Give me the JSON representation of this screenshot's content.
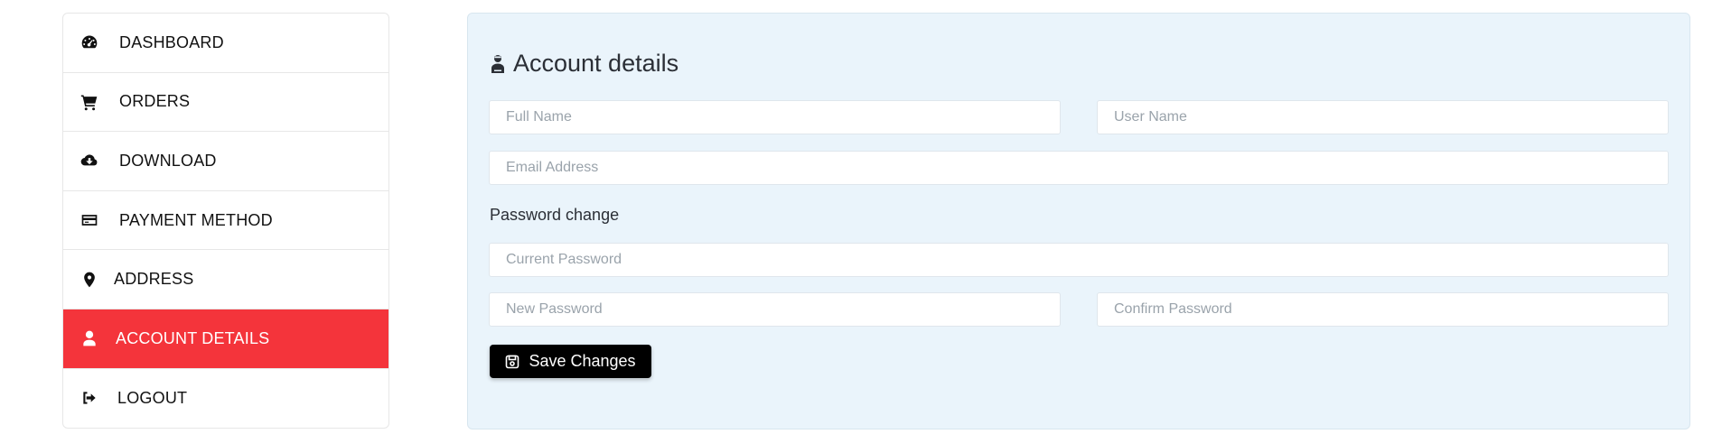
{
  "sidebar": {
    "items": [
      {
        "label": "DASHBOARD",
        "icon": "dashboard-gauge-icon",
        "active": false
      },
      {
        "label": "ORDERS",
        "icon": "cart-icon",
        "active": false
      },
      {
        "label": "DOWNLOAD",
        "icon": "cloud-download-icon",
        "active": false
      },
      {
        "label": "PAYMENT METHOD",
        "icon": "credit-card-icon",
        "active": false
      },
      {
        "label": "ADDRESS",
        "icon": "map-pin-icon",
        "active": false
      },
      {
        "label": "ACCOUNT DETAILS",
        "icon": "user-icon",
        "active": true
      },
      {
        "label": "LOGOUT",
        "icon": "sign-out-icon",
        "active": false
      }
    ]
  },
  "main": {
    "title": "Account details",
    "title_icon": "user-icon",
    "fields": {
      "full_name": {
        "placeholder": "Full Name",
        "value": ""
      },
      "user_name": {
        "placeholder": "User Name",
        "value": ""
      },
      "email": {
        "placeholder": "Email Address",
        "value": ""
      },
      "current_password": {
        "placeholder": "Current Password",
        "value": ""
      },
      "new_password": {
        "placeholder": "New Password",
        "value": ""
      },
      "confirm_password": {
        "placeholder": "Confirm Password",
        "value": ""
      }
    },
    "password_section_label": "Password change",
    "save_button": {
      "label": "Save Changes",
      "icon": "save-icon"
    }
  },
  "colors": {
    "active_accent": "#f4343b",
    "panel_background": "#eaf4fb",
    "button_background": "#000000"
  }
}
